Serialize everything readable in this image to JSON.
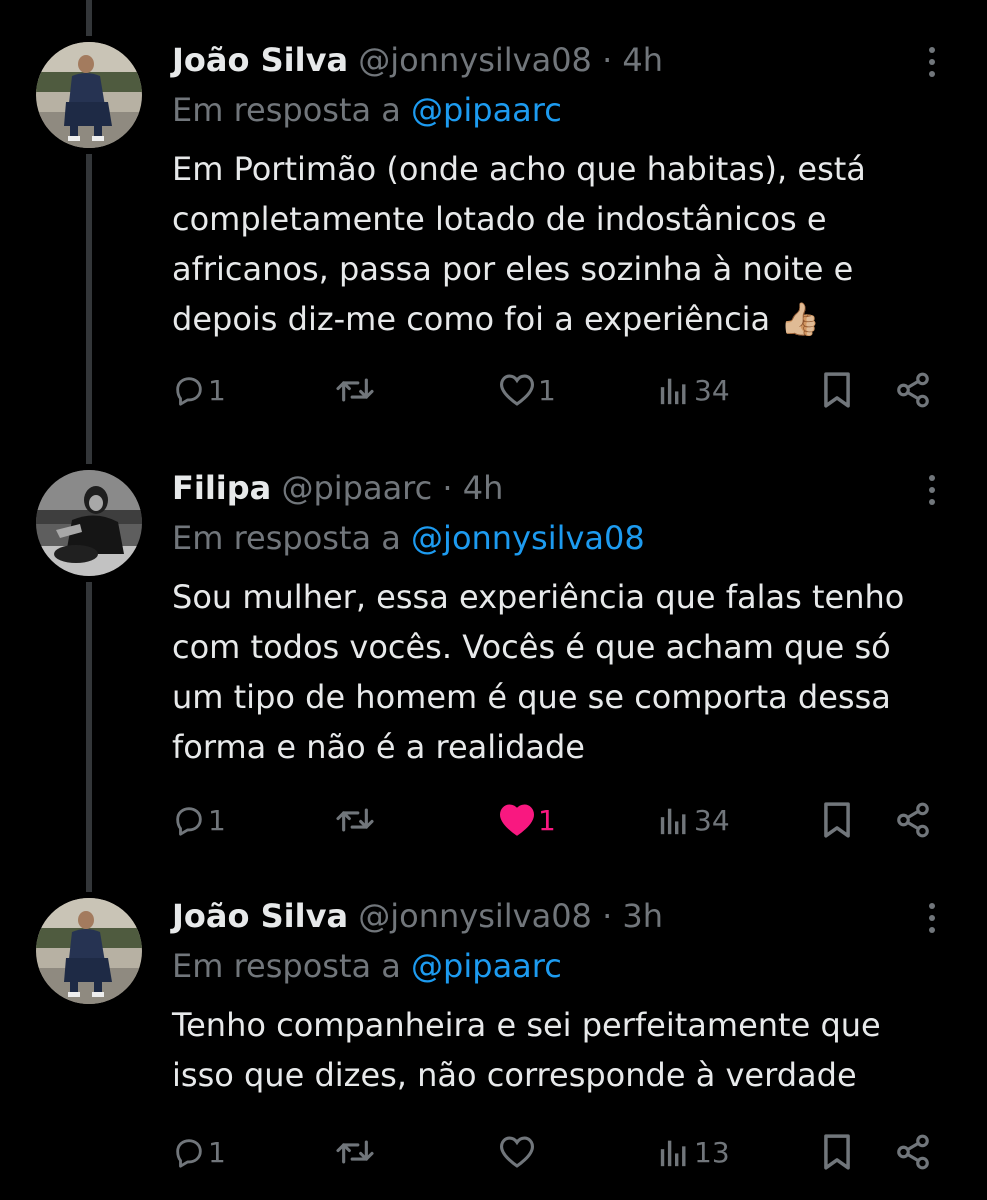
{
  "thread": {
    "tweets": [
      {
        "author_name": "João Silva",
        "handle": "@jonnysilva08",
        "separator": "·",
        "time": "4h",
        "reply_prefix": "Em resposta a",
        "reply_to": "@pipaarc",
        "lines": [
          "Em Portimão (onde acho que habitas), está",
          "completamente lotado de indostânicos e",
          "africanos, passa por eles sozinha à noite e",
          "depois diz-me como foi a experiência 👍🏼"
        ],
        "replies": "1",
        "reposts": "",
        "likes": "1",
        "liked": false,
        "views": "34",
        "avatar": "man-in-suit-photo"
      },
      {
        "author_name": "Filipa",
        "handle": "@pipaarc",
        "separator": "·",
        "time": "4h",
        "reply_prefix": "Em resposta a",
        "reply_to": "@jonnysilva08",
        "lines": [
          "Sou mulher, essa experiência que falas tenho",
          "com todos vocês. Vocês é que acham que só",
          "um tipo de homem é que se comporta dessa",
          "forma e não é a realidade"
        ],
        "replies": "1",
        "reposts": "",
        "likes": "1",
        "liked": true,
        "views": "34",
        "avatar": "woman-grayscale-photo"
      },
      {
        "author_name": "João Silva",
        "handle": "@jonnysilva08",
        "separator": "·",
        "time": "3h",
        "reply_prefix": "Em resposta a",
        "reply_to": "@pipaarc",
        "lines": [
          "Tenho companheira e sei perfeitamente que",
          "isso que dizes, não corresponde à verdade"
        ],
        "replies": "1",
        "reposts": "",
        "likes": "",
        "liked": false,
        "views": "13",
        "avatar": "man-in-suit-photo"
      }
    ]
  },
  "colors": {
    "background": "#000000",
    "text": "#e7e9ea",
    "muted": "#71767b",
    "link": "#1d9bf0",
    "like_active": "#f91880",
    "thread_line": "#333639"
  },
  "icons": [
    "reply-icon",
    "repost-icon",
    "like-icon",
    "views-icon",
    "bookmark-icon",
    "share-icon",
    "more-options-icon"
  ]
}
